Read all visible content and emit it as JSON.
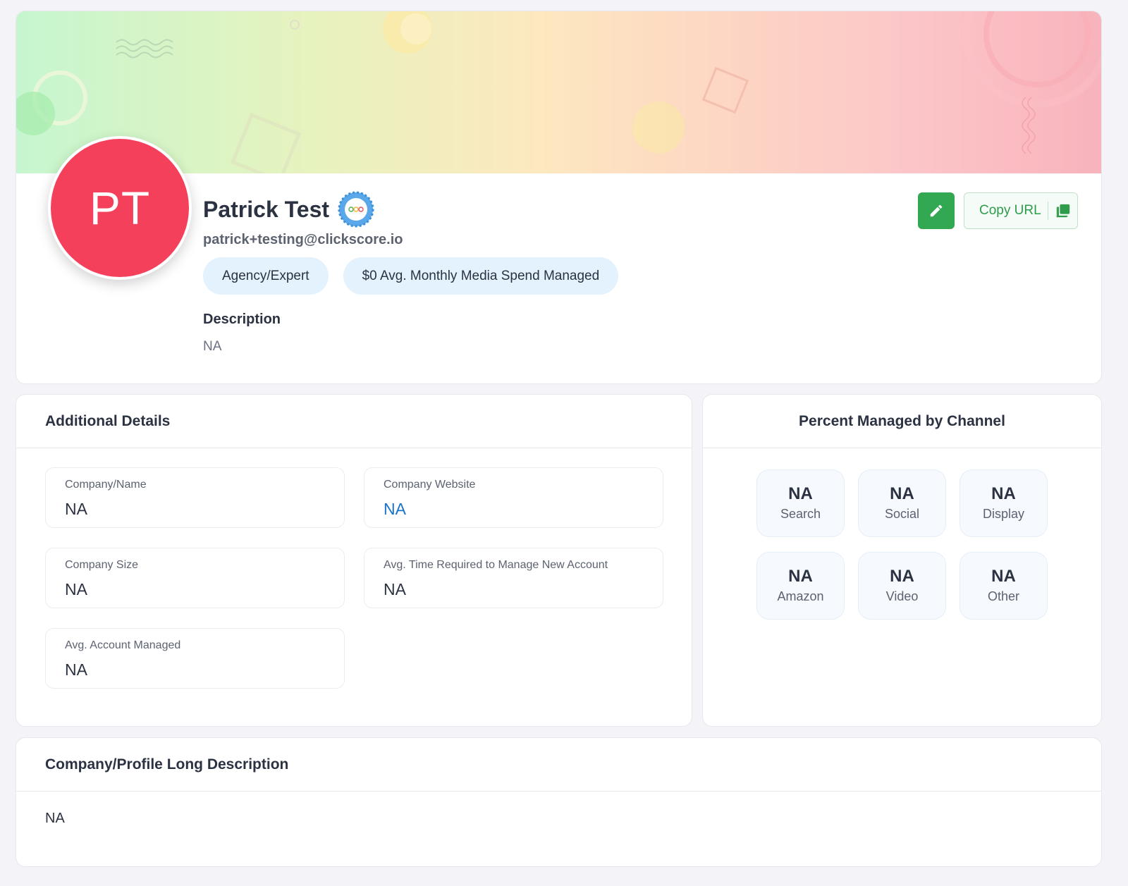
{
  "profile": {
    "avatar_initials": "PT",
    "name": "Patrick Test",
    "email": "patrick+testing@clickscore.io",
    "tags": [
      "Agency/Expert",
      "$0 Avg. Monthly Media Spend Managed"
    ],
    "description_title": "Description",
    "description_value": "NA",
    "copy_url_label": "Copy URL",
    "colors": {
      "avatar": "#f5405c",
      "edit_button": "#33a852",
      "tag_bg": "#e3f2fd",
      "link": "#1a73c8"
    },
    "icons": {
      "verified": "verified-badge-icon",
      "edit": "pencil-icon",
      "copy": "copy-icon"
    }
  },
  "details": {
    "title": "Additional Details",
    "fields": [
      {
        "label": "Company/Name",
        "value": "NA"
      },
      {
        "label": "Company Website",
        "value": "NA"
      },
      {
        "label": "Company Size",
        "value": "NA"
      },
      {
        "label": "Avg. Time Required to Manage New Account",
        "value": "NA"
      },
      {
        "label": "Avg. Account Managed",
        "value": "NA"
      }
    ]
  },
  "channels": {
    "title": "Percent Managed by Channel",
    "items": [
      {
        "value": "NA",
        "label": "Search"
      },
      {
        "value": "NA",
        "label": "Social"
      },
      {
        "value": "NA",
        "label": "Display"
      },
      {
        "value": "NA",
        "label": "Amazon"
      },
      {
        "value": "NA",
        "label": "Video"
      },
      {
        "value": "NA",
        "label": "Other"
      }
    ]
  },
  "long_description": {
    "title": "Company/Profile Long Description",
    "value": "NA"
  }
}
